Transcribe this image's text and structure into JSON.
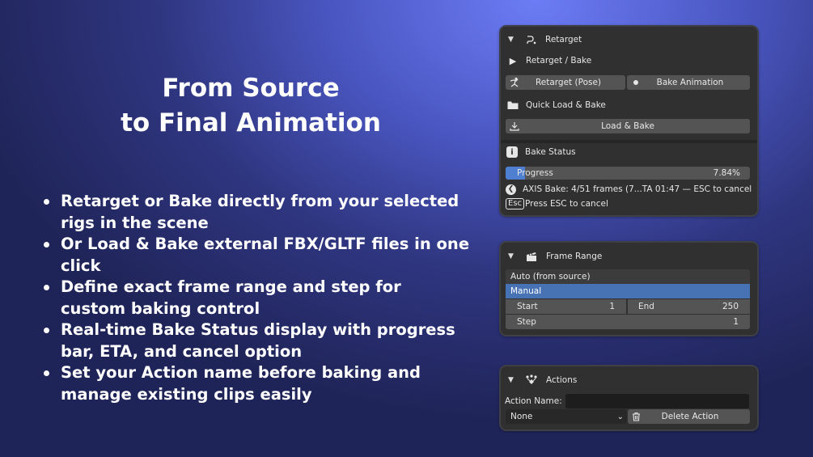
{
  "hero": {
    "title_line1": "From Source",
    "title_line2": "to Final Animation",
    "bullets": [
      "Retarget or Bake directly from your selected rigs in the scene",
      "Or Load & Bake external FBX/GLTF files in one click",
      "Define exact frame range and step for custom baking control",
      "Real-time Bake Status display with progress bar, ETA, and cancel option",
      "Set your Action name before baking and manage existing clips easily"
    ]
  },
  "retarget_panel": {
    "title": "Retarget",
    "retarget_bake_label": "Retarget / Bake",
    "retarget_pose_label": "Retarget (Pose)",
    "bake_animation_label": "Bake Animation",
    "quick_load_label": "Quick Load & Bake",
    "load_bake_label": "Load & Bake",
    "bake_status_label": "Bake Status",
    "progress_label": "Progress",
    "progress_value_text": "7.84%",
    "progress_fraction": 0.0784,
    "axis_bake_text": "AXIS Bake: 4/51 frames (7...TA 01:47 — ESC to cancel",
    "esc_key": "Esc",
    "esc_text": "Press ESC to cancel"
  },
  "frame_range_panel": {
    "title": "Frame Range",
    "options": [
      "Auto (from source)",
      "Manual"
    ],
    "selected_option": "Manual",
    "start_label": "Start",
    "start_value": "1",
    "end_label": "End",
    "end_value": "250",
    "step_label": "Step",
    "step_value": "1"
  },
  "actions_panel": {
    "title": "Actions",
    "action_name_label": "Action Name:",
    "action_name_value": "",
    "action_select_value": "None",
    "delete_action_label": "Delete Action"
  },
  "colors": {
    "panel_bg": "#303030",
    "button_bg": "#545454",
    "selected_blue": "#4772b3",
    "progress_blue": "#4f7fd0"
  },
  "icons": [
    "triangle-down-icon",
    "retarget-curve-icon",
    "play-icon",
    "pose-figure-icon",
    "dot-icon",
    "folder-icon",
    "import-icon",
    "info-icon",
    "chevron-left-icon",
    "clapper-icon",
    "actions-nodes-icon",
    "chevron-down-icon",
    "trash-icon"
  ]
}
